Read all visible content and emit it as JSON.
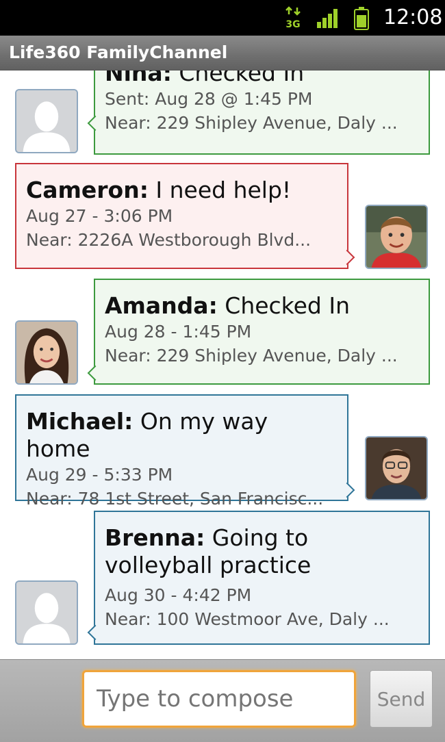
{
  "status_bar": {
    "network": "3G",
    "network_icon": "3g-data-icon",
    "signal_icon": "signal-strength-icon",
    "battery_icon": "battery-icon",
    "time": "12:08"
  },
  "app_bar": {
    "title": "Life360 FamilyChannel"
  },
  "messages": [
    {
      "sender": "Nina:",
      "text": "Checked In",
      "time": "Sent: Aug 28 @ 1:45 PM",
      "location": "Near: 229 Shipley Avenue, Daly ...",
      "status": "checked-in",
      "color": "#3c9a3e",
      "avatar": "default-person-icon"
    },
    {
      "sender": "Cameron:",
      "text": "I need help!",
      "time": "Aug 27 - 3:06 PM",
      "location": "Near: 2226A Westborough Blvd...",
      "status": "help",
      "color": "#c8353b",
      "avatar": "boy-photo"
    },
    {
      "sender": "Amanda:",
      "text": "Checked In",
      "time": "Aug 28 - 1:45 PM",
      "location": "Near: 229 Shipley Avenue, Daly ...",
      "status": "checked-in",
      "color": "#3c9a3e",
      "avatar": "girl-photo"
    },
    {
      "sender": "Michael:",
      "text": "On my way home",
      "time": "Aug 29 - 5:33 PM",
      "location": "Near: 78 1st Street, San Francisc...",
      "status": "message",
      "color": "#2f7598",
      "avatar": "man-photo"
    },
    {
      "sender": "Brenna:",
      "text": "Going to volleyball practice",
      "time": "Aug 30 - 4:42 PM",
      "location": "Near: 100 Westmoor Ave, Daly ...",
      "status": "message",
      "color": "#2f7598",
      "avatar": "default-person-icon"
    }
  ],
  "compose": {
    "placeholder": "Type to compose",
    "value": "",
    "send_label": "Send",
    "focus_color": "#f0a43a"
  }
}
